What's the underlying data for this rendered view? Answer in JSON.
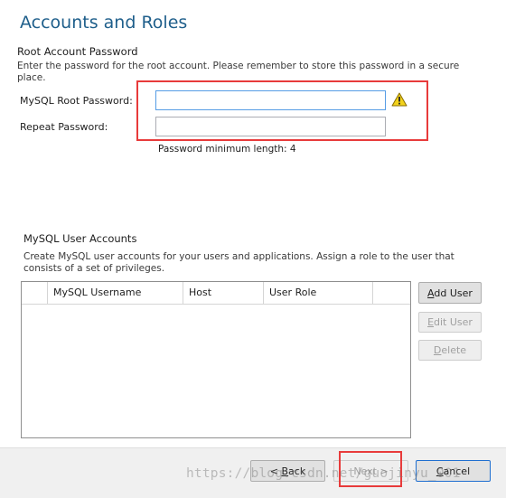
{
  "page": {
    "title": "Accounts and Roles"
  },
  "root_account": {
    "section_title": "Root Account Password",
    "description": "Enter the password for the root account.  Please remember to store this password in a secure place.",
    "root_password": {
      "label": "MySQL Root Password:",
      "value": ""
    },
    "repeat_password": {
      "label": "Repeat Password:",
      "value": ""
    },
    "hint": "Password minimum length: 4"
  },
  "user_accounts": {
    "section_title": "MySQL User Accounts",
    "description": "Create MySQL user accounts for your users and applications. Assign a role to the user that consists of a set of privileges.",
    "columns": [
      "MySQL Username",
      "Host",
      "User Role"
    ],
    "rows": []
  },
  "buttons": {
    "add_user": {
      "first": "A",
      "rest": "dd User"
    },
    "edit_user": {
      "first": "E",
      "rest": "dit User"
    },
    "delete": {
      "first": "D",
      "rest": "elete"
    }
  },
  "footer": {
    "back": {
      "prefix": "< ",
      "mnemonic": "B",
      "rest": "ack"
    },
    "next": {
      "label": "Next >"
    },
    "cancel": {
      "mnemonic": "C",
      "rest": "ancel"
    }
  },
  "watermark": {
    "text": "https://blog.csdn.net/guojinyu_001"
  },
  "colors": {
    "title": "#1f5f8b",
    "highlight": "#e83b3b",
    "focus_border": "#569de5",
    "warning": "#f2d21b"
  },
  "icons": {
    "warning": "warning-icon"
  }
}
